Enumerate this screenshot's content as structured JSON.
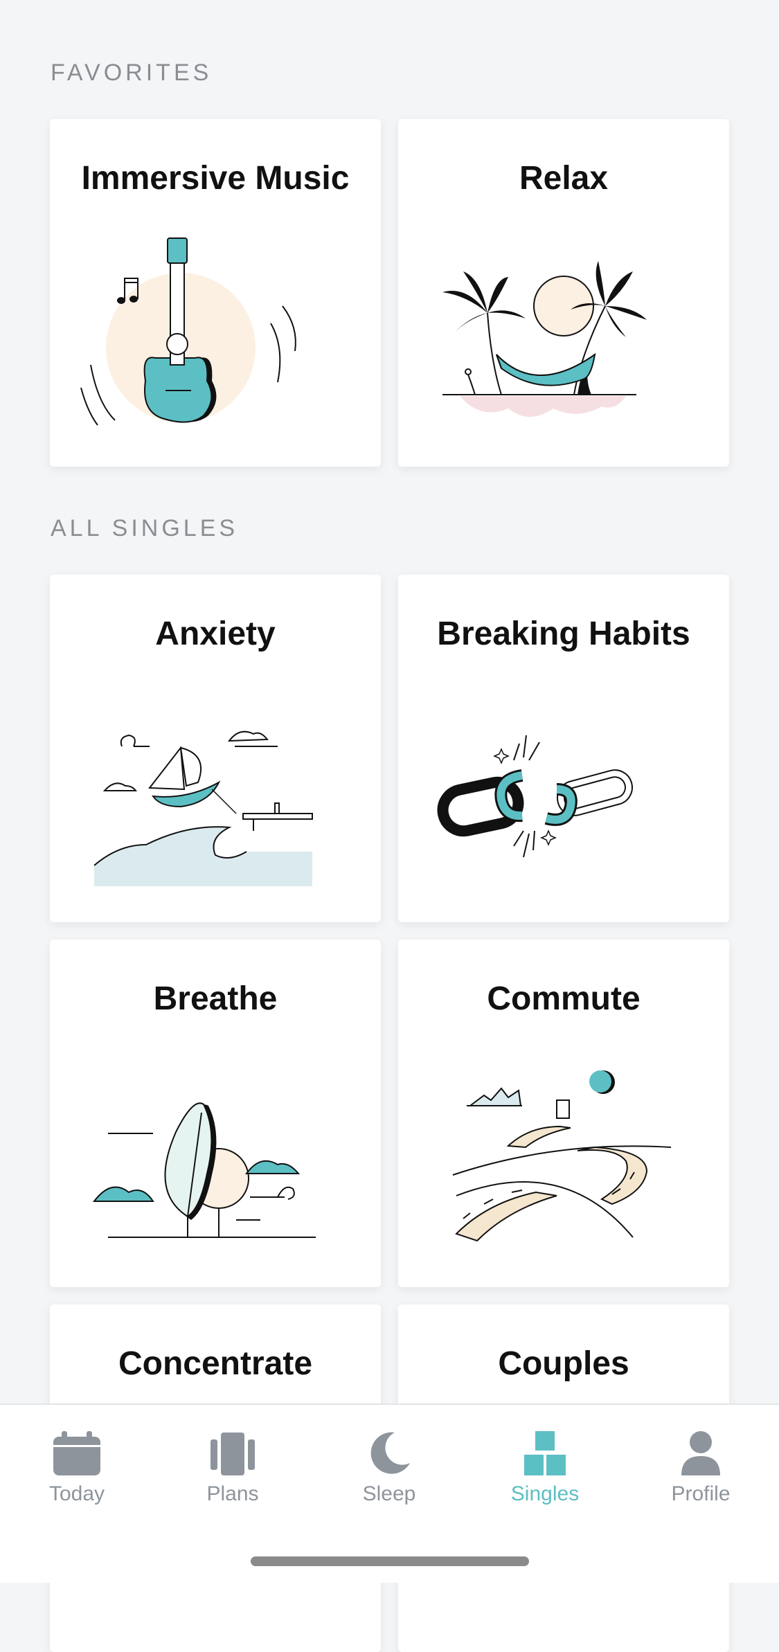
{
  "sections": {
    "favorites_title": "FAVORITES",
    "all_singles_title": "ALL SINGLES"
  },
  "favorites": [
    {
      "title": "Immersive Music",
      "icon": "guitar-illustration"
    },
    {
      "title": "Relax",
      "icon": "hammock-palm-illustration"
    }
  ],
  "singles": [
    {
      "title": "Anxiety",
      "icon": "sailboat-wave-illustration"
    },
    {
      "title": "Breaking Habits",
      "icon": "broken-chain-illustration"
    },
    {
      "title": "Breathe",
      "icon": "leaf-cloud-illustration"
    },
    {
      "title": "Commute",
      "icon": "winding-road-illustration"
    },
    {
      "title": "Concentrate",
      "icon": ""
    },
    {
      "title": "Couples",
      "icon": ""
    }
  ],
  "tabbar": {
    "active": "Singles",
    "accent_color": "#5cbfc4",
    "inactive_color": "#8e949b",
    "items": [
      {
        "label": "Today",
        "icon": "calendar-icon"
      },
      {
        "label": "Plans",
        "icon": "plans-icon"
      },
      {
        "label": "Sleep",
        "icon": "moon-icon"
      },
      {
        "label": "Singles",
        "icon": "grid-blocks-icon"
      },
      {
        "label": "Profile",
        "icon": "person-icon"
      }
    ]
  },
  "colors": {
    "teal": "#5cbfc4",
    "peach": "#fcf0e2",
    "background": "#f4f5f7"
  }
}
